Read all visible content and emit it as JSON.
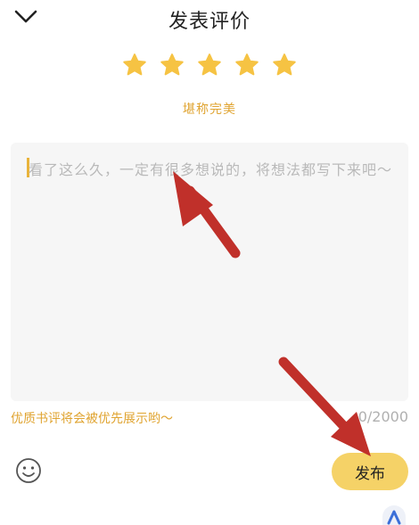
{
  "header": {
    "title": "发表评价",
    "back_icon": "chevron-down-icon"
  },
  "rating": {
    "stars": 5,
    "max_stars": 5,
    "star_color": "#f6c343",
    "text": "堪称完美"
  },
  "review": {
    "placeholder": "看了这么久，一定有很多想说的，将想法都写下来吧～",
    "hint": "优质书评将会被优先展示哟～",
    "char_count": "0/2000"
  },
  "footer": {
    "emoji_icon": "smiley-icon",
    "publish_label": "发布"
  },
  "colors": {
    "accent": "#e0a431",
    "button": "#f5d267",
    "annotation_arrow": "#c0302a",
    "input_bg": "#f6f6f6"
  }
}
